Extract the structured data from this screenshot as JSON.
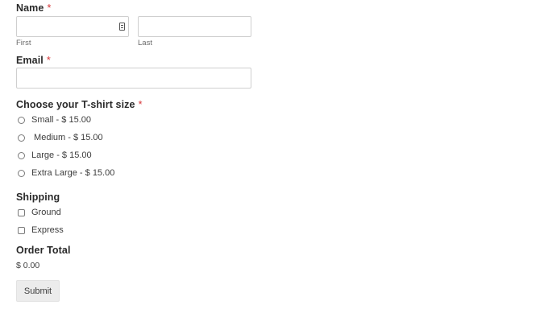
{
  "name_field": {
    "label": "Name",
    "required_mark": "*",
    "first_value": "",
    "first_sublabel": "First",
    "last_value": "",
    "last_sublabel": "Last"
  },
  "email_field": {
    "label": "Email",
    "required_mark": "*",
    "value": ""
  },
  "tshirt_field": {
    "label": "Choose your T-shirt size",
    "required_mark": "*",
    "options": [
      {
        "label": "Small - $ 15.00",
        "selected": false
      },
      {
        "label": " Medium - $ 15.00",
        "selected": false
      },
      {
        "label": "Large - $ 15.00",
        "selected": false
      },
      {
        "label": "Extra Large - $ 15.00",
        "selected": false
      }
    ]
  },
  "shipping_field": {
    "label": "Shipping",
    "options": [
      {
        "label": "Ground",
        "checked": false
      },
      {
        "label": "Express",
        "checked": false
      }
    ]
  },
  "order_total": {
    "label": "Order Total",
    "value": "$ 0.00"
  },
  "submit": {
    "label": "Submit"
  },
  "icons": {
    "autofill": "contact-card-icon"
  },
  "colors": {
    "required": "#d63638",
    "button_bg": "#ececec",
    "input_border": "#cfcfcf"
  }
}
